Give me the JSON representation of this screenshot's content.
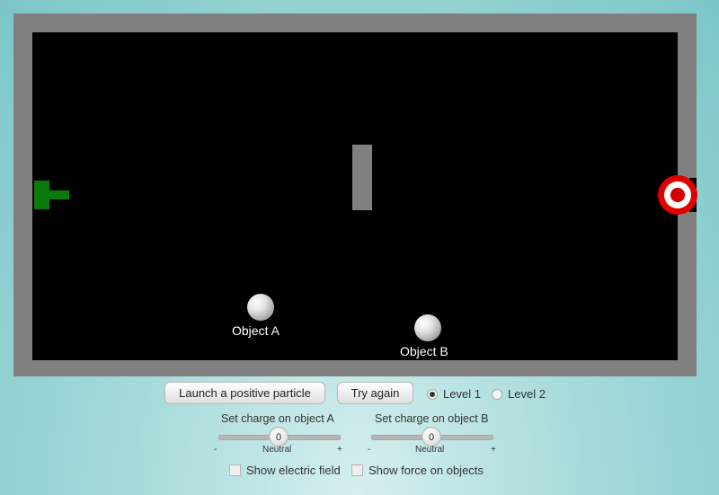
{
  "simulation": {
    "object_a_label": "Object A",
    "object_b_label": "Object B"
  },
  "controls": {
    "launch_label": "Launch a positive particle",
    "try_again_label": "Try again",
    "level1_label": "Level 1",
    "level2_label": "Level 2",
    "selected_level": "Level 1"
  },
  "slider_a": {
    "label": "Set charge on object A",
    "value": "0",
    "minus": "-",
    "plus": "+",
    "center_label": "Neutral"
  },
  "slider_b": {
    "label": "Set charge on object B",
    "value": "0",
    "minus": "-",
    "plus": "+",
    "center_label": "Neutral"
  },
  "options": {
    "show_field_label": "Show electric field",
    "show_force_label": "Show force on objects",
    "show_field_checked": false,
    "show_force_checked": false
  },
  "colors": {
    "launcher": "#0a7a0a",
    "target": "#e00000",
    "frame": "#808080",
    "field": "#000000"
  }
}
